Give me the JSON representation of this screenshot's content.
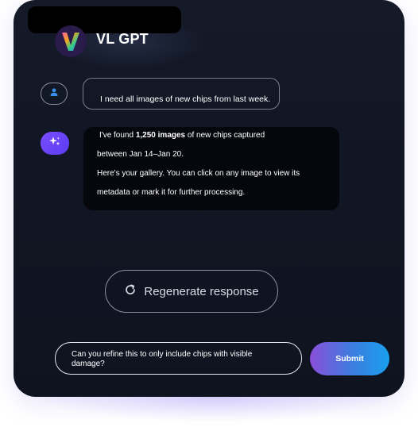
{
  "app": {
    "title": "VL GPT",
    "logo_icon": "v-logo-icon",
    "colors": {
      "background": "#111624",
      "accent": "#6a45f5",
      "submit_gradient_start": "#8a4fd8",
      "submit_gradient_end": "#1aa0ee"
    }
  },
  "conversation": {
    "user_message": {
      "icon": "user-icon",
      "text": "I need all images of new chips from last week."
    },
    "assistant_message": {
      "icon": "sparkle-icon",
      "line1_prefix": "I've found ",
      "line1_bold": "1,250 images",
      "line1_suffix": " of new chips captured",
      "line2": "between Jan 14–Jan 20.",
      "line3": "Here's your gallery. You can click on any image to view its",
      "line4": "metadata or mark it for further processing."
    }
  },
  "actions": {
    "regenerate_label": "Regenerate response",
    "regenerate_icon": "refresh-icon"
  },
  "composer": {
    "input_value": "Can you refine this to only include chips with visible damage?",
    "submit_label": "Submit"
  }
}
